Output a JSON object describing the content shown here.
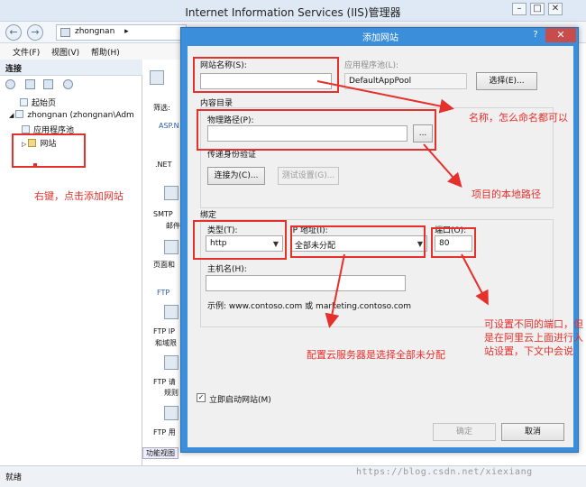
{
  "window": {
    "title": "Internet Information Services (IIS)管理器",
    "controls": {
      "minimize": "–",
      "maximize": "□",
      "close": "✕"
    }
  },
  "nav": {
    "back": "←",
    "forward": "→",
    "address": "zhongnan",
    "address_arrow": "▸"
  },
  "menu": [
    "文件(F)",
    "视图(V)",
    "帮助(H)"
  ],
  "connections": {
    "header": "连接",
    "tree": [
      {
        "label": "起始页"
      },
      {
        "label": "zhongnan (zhongnan\\Adm"
      },
      {
        "label": "应用程序池"
      },
      {
        "label": "网站"
      }
    ]
  },
  "middle_panel": {
    "filter": "筛选:",
    "items": [
      "ASP.N",
      ".NET",
      "SMTP",
      "邮件",
      "页面和",
      "FTP",
      "FTP IP",
      "和域限",
      "FTP 请",
      "规则",
      "FTP 用"
    ]
  },
  "bottom_tab": "功能视图",
  "status": "就绪",
  "watermark": "https://blog.csdn.net/xiexiang",
  "dialog": {
    "title": "添加网站",
    "help": "?",
    "close": "✕",
    "site_name_label": "网站名称(S):",
    "site_name_value": "",
    "app_pool_label": "应用程序池(L):",
    "app_pool_value": "DefaultAppPool",
    "select_button": "选择(E)...",
    "content_dir_label": "内容目录",
    "physical_path_label": "物理路径(P):",
    "physical_path_value": "",
    "browse_button": "...",
    "passthrough_label": "传递身份验证",
    "connect_as_button": "连接为(C)...",
    "test_settings_button": "测试设置(G)...",
    "binding_label": "绑定",
    "type_label": "类型(T):",
    "type_value": "http",
    "ip_label": "IP 地址(I):",
    "ip_value": "全部未分配",
    "port_label": "端口(O):",
    "port_value": "80",
    "hostname_label": "主机名(H):",
    "hostname_value": "",
    "example_text": "示例: www.contoso.com 或 marketing.contoso.com",
    "start_immediately_label": "立即启动网站(M)",
    "start_immediately_checked": true,
    "ok_button": "确定",
    "cancel_button": "取消"
  },
  "annotations": {
    "right_click": "右键，点击添加网站",
    "name": "名称，怎么命名都可以",
    "path": "项目的本地路径",
    "ip": "配置云服务器是选择全部未分配",
    "port": "可设置不同的端口，但是在阿里云上面进行入站设置，下文中会说"
  },
  "colors": {
    "annotation": "#e5302c",
    "dialog_frame": "#3b8ed9",
    "close": "#c94c4c"
  }
}
